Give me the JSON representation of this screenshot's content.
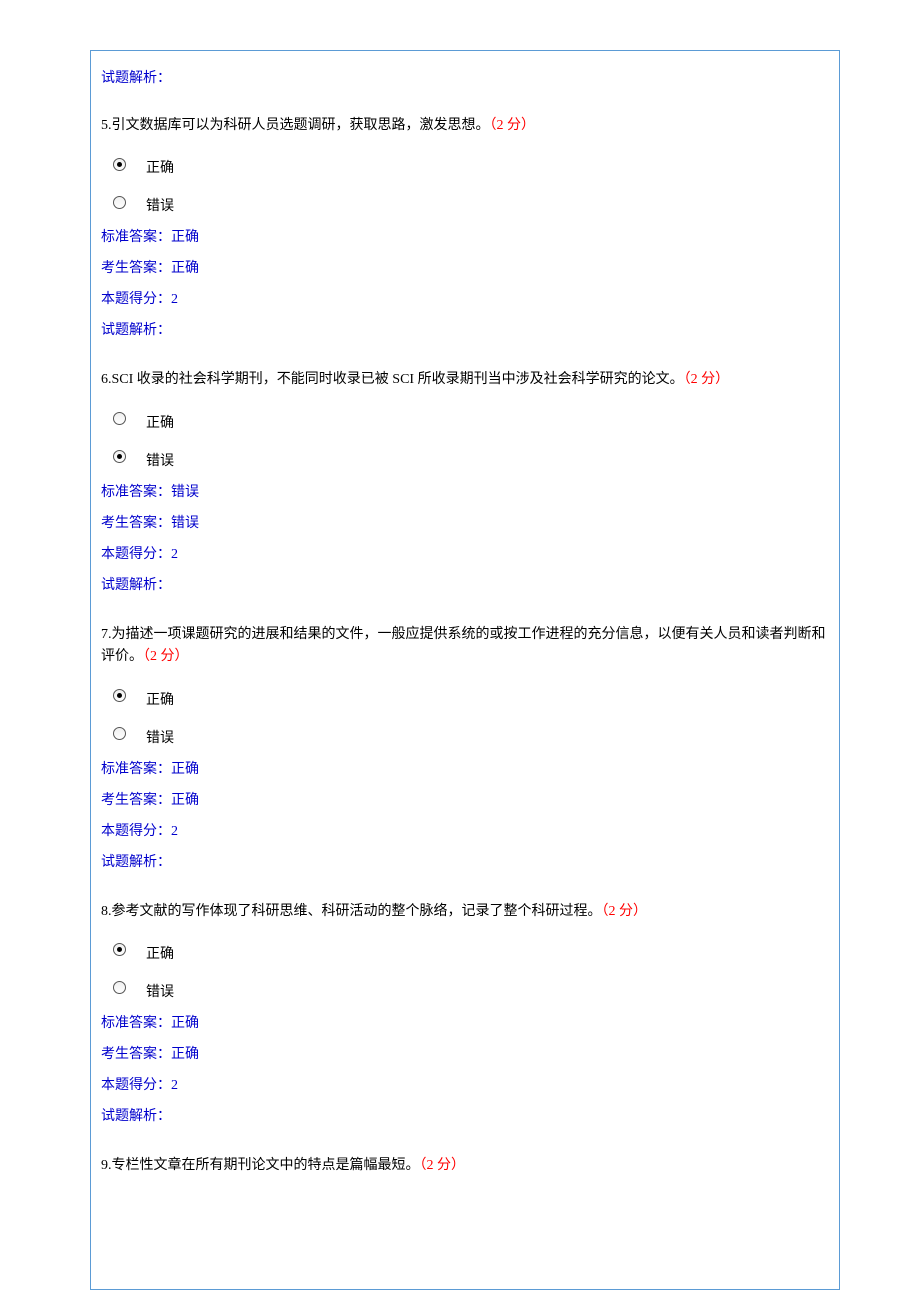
{
  "labels": {
    "analysis": "试题解析：",
    "standard_answer_prefix": "标准答案：",
    "student_answer_prefix": "考生答案：",
    "score_prefix": "本题得分：",
    "correct": "正确",
    "wrong": "错误",
    "points_format": "（2 分）"
  },
  "top_analysis": "试题解析：",
  "questions": [
    {
      "number": "5.",
      "text": "引文数据库可以为科研人员选题调研，获取思路，激发思想。",
      "points": "（2 分）",
      "options": [
        {
          "label": "正确",
          "selected": true
        },
        {
          "label": "错误",
          "selected": false
        }
      ],
      "standard_answer": "正确",
      "student_answer": "正确",
      "score": "2",
      "analysis": ""
    },
    {
      "number": "6.",
      "text": "SCI 收录的社会科学期刊，不能同时收录已被 SCI 所收录期刊当中涉及社会科学研究的论文。",
      "points": "（2 分）",
      "options": [
        {
          "label": "正确",
          "selected": false
        },
        {
          "label": "错误",
          "selected": true
        }
      ],
      "standard_answer": "错误",
      "student_answer": "错误",
      "score": "2",
      "analysis": ""
    },
    {
      "number": "7.",
      "text": "为描述一项课题研究的进展和结果的文件，一般应提供系统的或按工作进程的充分信息，以便有关人员和读者判断和评价。",
      "points": "（2 分）",
      "options": [
        {
          "label": "正确",
          "selected": true
        },
        {
          "label": "错误",
          "selected": false
        }
      ],
      "standard_answer": "正确",
      "student_answer": "正确",
      "score": "2",
      "analysis": ""
    },
    {
      "number": "8.",
      "text": "参考文献的写作体现了科研思维、科研活动的整个脉络，记录了整个科研过程。",
      "points": "（2 分）",
      "options": [
        {
          "label": "正确",
          "selected": true
        },
        {
          "label": "错误",
          "selected": false
        }
      ],
      "standard_answer": "正确",
      "student_answer": "正确",
      "score": "2",
      "analysis": ""
    },
    {
      "number": "9.",
      "text": "专栏性文章在所有期刊论文中的特点是篇幅最短。",
      "points": "（2 分）",
      "partial": true
    }
  ]
}
